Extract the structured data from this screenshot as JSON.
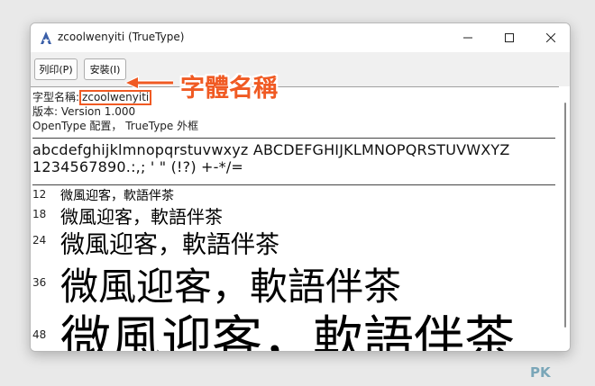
{
  "window": {
    "title": "zcoolwenyiti (TrueType)",
    "controls": {
      "minimize_icon": "minimize-icon",
      "maximize_icon": "maximize-icon",
      "close_icon": "close-icon"
    }
  },
  "toolbar": {
    "print_label": "列印(P)",
    "install_label": "安裝(I)"
  },
  "info": {
    "font_name_label": "字型名稱:",
    "font_name": "zcoolwenyiti",
    "version": "版本: Version 1.000",
    "opentype": "OpenType 配置， TrueType 外框"
  },
  "alphabet": {
    "line1": "abcdefghijklmnopqrstuvwxyz ABCDEFGHIJKLMNOPQRSTUVWXYZ",
    "line2": "1234567890.:,; ' \" (!?) +-*/="
  },
  "samples": [
    {
      "size": "12",
      "text": "微風迎客，軟語伴茶"
    },
    {
      "size": "18",
      "text": "微風迎客，軟語伴茶"
    },
    {
      "size": "24",
      "text": "微風迎客，軟語伴茶"
    },
    {
      "size": "36",
      "text": "微風迎客，軟語伴茶"
    },
    {
      "size": "48",
      "text": "微風迎客，軟語伴茶"
    }
  ],
  "annotation": {
    "label": "字體名稱",
    "color": "#f05a23"
  },
  "watermark": {
    "text": "PK"
  }
}
